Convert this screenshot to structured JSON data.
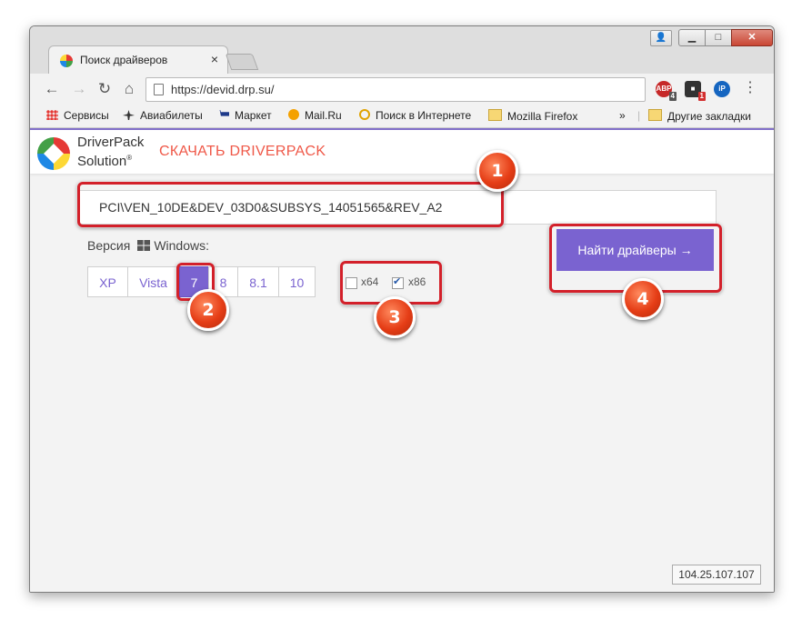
{
  "browser": {
    "tab_title": "Поиск драйверов",
    "tab_close": "×",
    "url": "https://devid.drp.su/",
    "nav": {
      "back": "←",
      "forward": "→",
      "reload": "↻",
      "home": "⌂"
    },
    "window_buttons": {
      "user": "👤",
      "minimize": "▁",
      "maximize": "□",
      "close": "✕"
    },
    "extensions": [
      {
        "name": "adblock",
        "label": "ABP",
        "badge": "4",
        "color": "#c62828"
      },
      {
        "name": "feed",
        "label": "■",
        "badge": "1",
        "color": "#333333"
      },
      {
        "name": "ip",
        "label": "iP",
        "badge": "",
        "color": "#1565c0"
      }
    ],
    "menu": "⋮",
    "bookmarks": [
      {
        "label": "Сервисы",
        "icon": "apps-grid-icon"
      },
      {
        "label": "Авиабилеты",
        "icon": "airplane-icon"
      },
      {
        "label": "Маркет",
        "icon": "cart-icon"
      },
      {
        "label": "Mail.Ru",
        "icon": "at-icon"
      },
      {
        "label": "Поиск в Интернете",
        "icon": "search-icon"
      },
      {
        "label": "Mozilla Firefox",
        "icon": "folder-icon"
      }
    ],
    "bookmarks_overflow": "»",
    "other_bookmarks": "Другие закладки"
  },
  "site": {
    "logo_line1": "DriverPack",
    "logo_line2": "Solution",
    "logo_reg": "®",
    "download_link": "СКАЧАТЬ DRIVERPACK",
    "device_id": "PCI\\VEN_10DE&DEV_03D0&SUBSYS_14051565&REV_A2",
    "version_label": "Версия",
    "os_label": "Windows:",
    "versions": [
      "XP",
      "Vista",
      "7",
      "8",
      "8.1",
      "10"
    ],
    "selected_version": "7",
    "arch": [
      {
        "label": "x64",
        "checked": false
      },
      {
        "label": "x86",
        "checked": true
      }
    ],
    "find_button": "Найти драйверы →",
    "ip_address": "104.25.107.107"
  },
  "annotations": [
    "1",
    "2",
    "3",
    "4"
  ],
  "colors": {
    "accent": "#7a63d0",
    "link": "#ef5848",
    "highlight": "#d3202a",
    "marker": "#e53d16"
  }
}
